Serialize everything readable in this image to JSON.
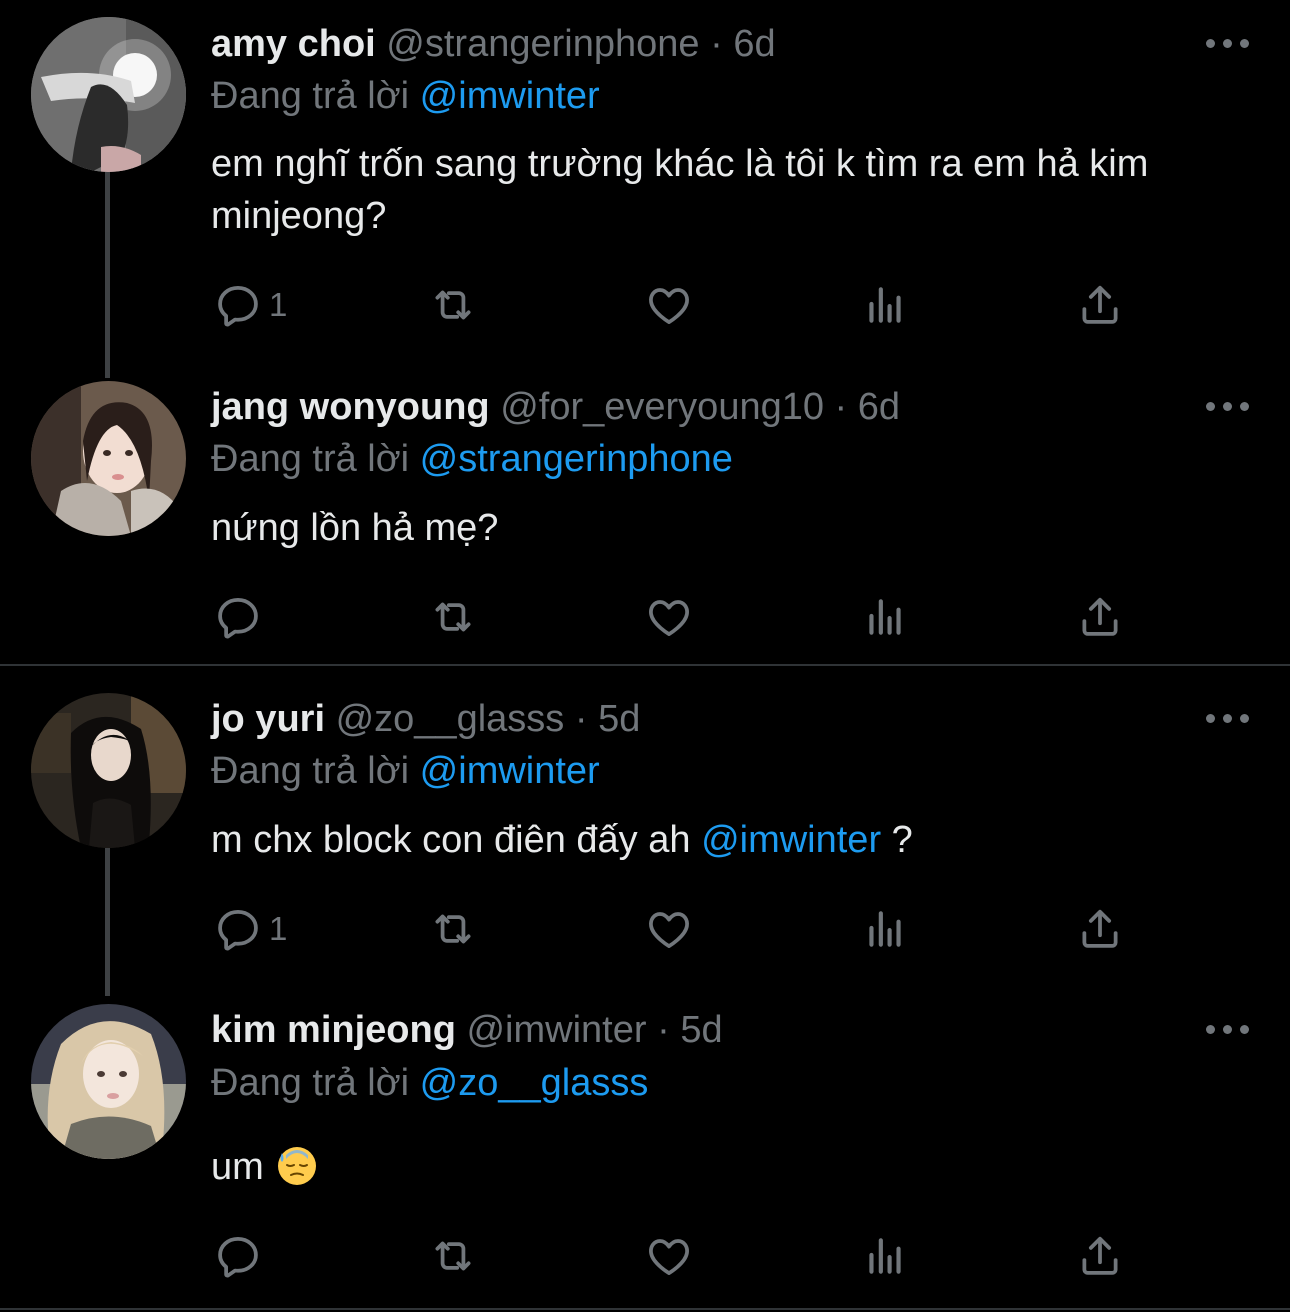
{
  "labels": {
    "replying_to": "Đang trả lời",
    "separator": "·"
  },
  "colors": {
    "background": "#000000",
    "text": "#e7e9ea",
    "muted": "#71767b",
    "accent": "#1d9bf0",
    "thread_line": "#3e4144"
  },
  "tweets": [
    {
      "display_name": "amy choi",
      "handle": "@strangerinphone",
      "time": "6d",
      "reply_to": "@imwinter",
      "text": "em nghĩ trốn sang trường khác là tôi k tìm ra em hả kim minjeong?",
      "reply_count": "1"
    },
    {
      "display_name": "jang wonyoung",
      "handle": "@for_everyoung10",
      "time": "6d",
      "reply_to": "@strangerinphone",
      "text": "nứng lồn hả mẹ?",
      "reply_count": ""
    },
    {
      "display_name": "jo yuri",
      "handle": "@zo__glasss",
      "time": "5d",
      "reply_to": "@imwinter",
      "text_before": "m chx block con điên đấy ah ",
      "text_mention": "@imwinter",
      "text_after": " ?",
      "reply_count": "1"
    },
    {
      "display_name": "kim minjeong",
      "handle": "@imwinter",
      "time": "5d",
      "reply_to": "@zo__glasss",
      "text": "um",
      "emoji": "downcast-face-with-sweat",
      "reply_count": ""
    }
  ],
  "icons": {
    "reply": "reply-icon",
    "retweet": "retweet-icon",
    "like": "like-icon",
    "views": "views-icon",
    "share": "share-icon",
    "more": "more-icon"
  }
}
